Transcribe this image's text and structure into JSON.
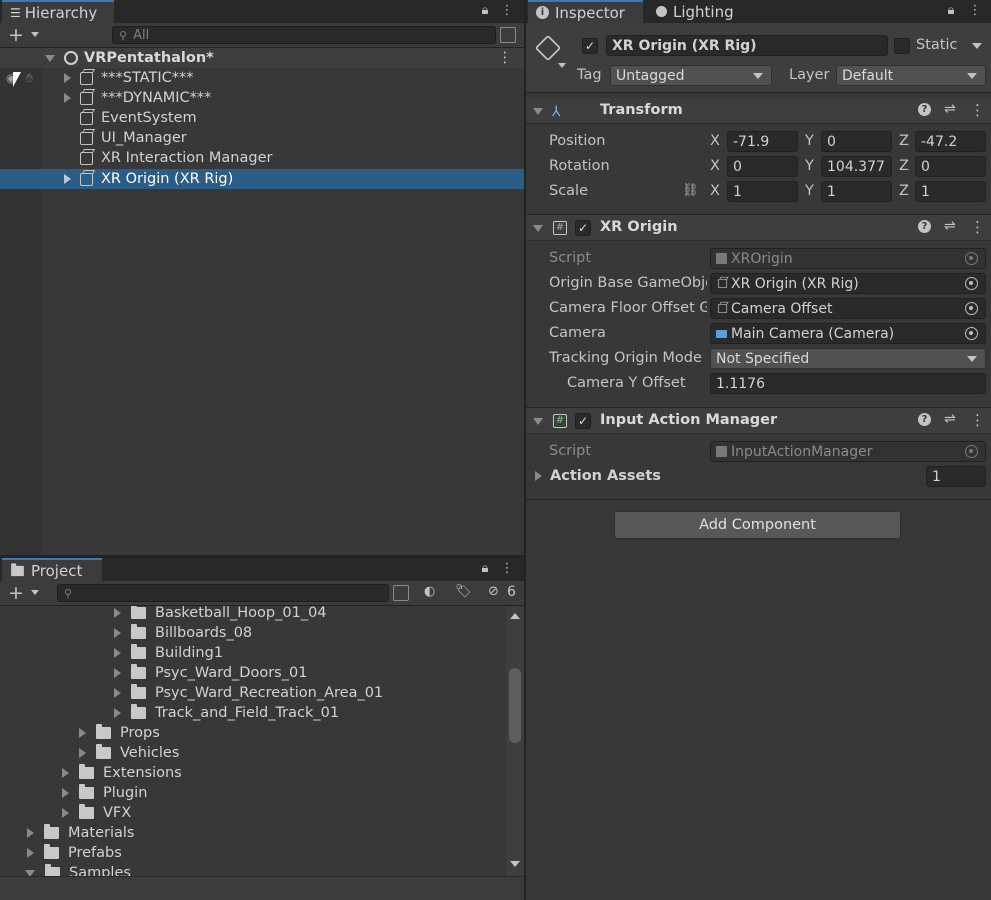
{
  "hierarchy": {
    "tab_label": "Hierarchy",
    "search_placeholder": "All",
    "scene_name": "VRPentathalon*",
    "items": [
      {
        "label": "***STATIC***",
        "has_children": true
      },
      {
        "label": "***DYNAMIC***",
        "has_children": true
      },
      {
        "label": "EventSystem",
        "has_children": false
      },
      {
        "label": "UI_Manager",
        "has_children": false
      },
      {
        "label": "XR Interaction Manager",
        "has_children": false
      },
      {
        "label": "XR Origin (XR Rig)",
        "has_children": true,
        "selected": true
      }
    ]
  },
  "project": {
    "tab_label": "Project",
    "hidden_count": "6",
    "items": [
      {
        "label": "Basketball_Hoop_01_04",
        "depth": 3
      },
      {
        "label": "Billboards_08",
        "depth": 3
      },
      {
        "label": "Building1",
        "depth": 3
      },
      {
        "label": "Psyc_Ward_Doors_01",
        "depth": 3
      },
      {
        "label": "Psyc_Ward_Recreation_Area_01",
        "depth": 3
      },
      {
        "label": "Track_and_Field_Track_01",
        "depth": 3
      },
      {
        "label": "Props",
        "depth": 2
      },
      {
        "label": "Vehicles",
        "depth": 2
      },
      {
        "label": "Extensions",
        "depth": 1
      },
      {
        "label": "Plugin",
        "depth": 1
      },
      {
        "label": "VFX",
        "depth": 1
      },
      {
        "label": "Materials",
        "depth": 0
      },
      {
        "label": "Prefabs",
        "depth": 0
      },
      {
        "label": "Samples",
        "depth": 0
      }
    ]
  },
  "inspector": {
    "tab_label": "Inspector",
    "lighting_tab_label": "Lighting",
    "object_name": "XR Origin (XR Rig)",
    "static_label": "Static",
    "tag_label": "Tag",
    "tag_value": "Untagged",
    "layer_label": "Layer",
    "layer_value": "Default",
    "transform": {
      "title": "Transform",
      "position_label": "Position",
      "rotation_label": "Rotation",
      "scale_label": "Scale",
      "x": "X",
      "y": "Y",
      "z": "Z",
      "position": [
        "-71.9",
        "0",
        "-47.2"
      ],
      "rotation": [
        "0",
        "104.377",
        "0"
      ],
      "scale": [
        "1",
        "1",
        "1"
      ]
    },
    "xr_origin": {
      "title": "XR Origin",
      "script_label": "Script",
      "script_value": "XROrigin",
      "origin_base_label": "Origin Base GameObje",
      "origin_base_value": "XR Origin (XR Rig)",
      "camera_floor_label": "Camera Floor Offset G",
      "camera_floor_value": "Camera Offset",
      "camera_label": "Camera",
      "camera_value": "Main Camera (Camera)",
      "tracking_label": "Tracking Origin Mode",
      "tracking_value": "Not Specified",
      "camera_y_label": "Camera Y Offset",
      "camera_y_value": "1.1176"
    },
    "input_action_manager": {
      "title": "Input Action Manager",
      "script_label": "Script",
      "script_value": "InputActionManager",
      "action_assets_label": "Action Assets",
      "action_assets_count": "1"
    },
    "add_component_label": "Add Component"
  }
}
